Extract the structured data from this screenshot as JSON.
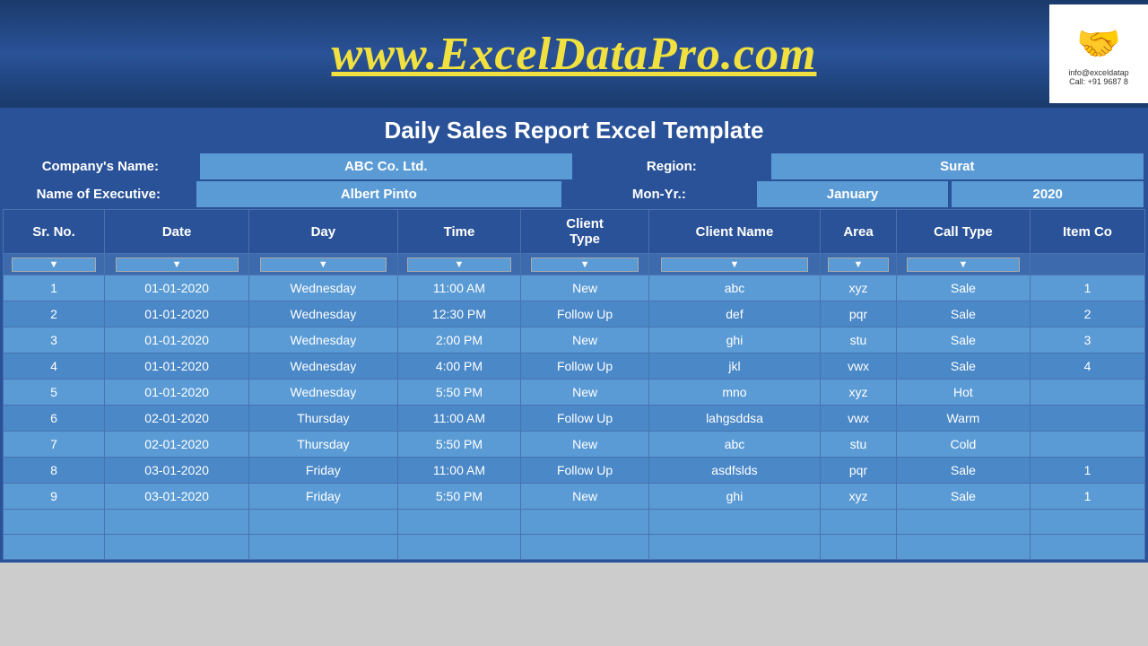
{
  "header": {
    "site_url": "www.ExcelDataPro.com",
    "logo_info": "info@exceldatap\nCall: +91 9687 8",
    "logo_emoji": "🤝"
  },
  "report_title": "Daily Sales Report Excel Template",
  "company_info": {
    "company_label": "Company's Name:",
    "company_value": "ABC Co. Ltd.",
    "region_label": "Region:",
    "region_value": "Surat",
    "executive_label": "Name of Executive:",
    "executive_value": "Albert Pinto",
    "mon_yr_label": "Mon-Yr.:",
    "mon_yr_value": "January",
    "year_value": "2020"
  },
  "columns": [
    "Sr. No.",
    "Date",
    "Day",
    "Time",
    "Client\nType",
    "Client Name",
    "Area",
    "Call Type",
    "Item Co"
  ],
  "rows": [
    {
      "sr": "1",
      "date": "01-01-2020",
      "day": "Wednesday",
      "time": "11:00 AM",
      "client_type": "New",
      "client_name": "abc",
      "area": "xyz",
      "call_type": "Sale",
      "item_code": "1"
    },
    {
      "sr": "2",
      "date": "01-01-2020",
      "day": "Wednesday",
      "time": "12:30 PM",
      "client_type": "Follow Up",
      "client_name": "def",
      "area": "pqr",
      "call_type": "Sale",
      "item_code": "2"
    },
    {
      "sr": "3",
      "date": "01-01-2020",
      "day": "Wednesday",
      "time": "2:00 PM",
      "client_type": "New",
      "client_name": "ghi",
      "area": "stu",
      "call_type": "Sale",
      "item_code": "3"
    },
    {
      "sr": "4",
      "date": "01-01-2020",
      "day": "Wednesday",
      "time": "4:00 PM",
      "client_type": "Follow Up",
      "client_name": "jkl",
      "area": "vwx",
      "call_type": "Sale",
      "item_code": "4"
    },
    {
      "sr": "5",
      "date": "01-01-2020",
      "day": "Wednesday",
      "time": "5:50 PM",
      "client_type": "New",
      "client_name": "mno",
      "area": "xyz",
      "call_type": "Hot",
      "item_code": ""
    },
    {
      "sr": "6",
      "date": "02-01-2020",
      "day": "Thursday",
      "time": "11:00 AM",
      "client_type": "Follow Up",
      "client_name": "lahgsddsa",
      "area": "vwx",
      "call_type": "Warm",
      "item_code": ""
    },
    {
      "sr": "7",
      "date": "02-01-2020",
      "day": "Thursday",
      "time": "5:50 PM",
      "client_type": "New",
      "client_name": "abc",
      "area": "stu",
      "call_type": "Cold",
      "item_code": ""
    },
    {
      "sr": "8",
      "date": "03-01-2020",
      "day": "Friday",
      "time": "11:00 AM",
      "client_type": "Follow Up",
      "client_name": "asdfslds",
      "area": "pqr",
      "call_type": "Sale",
      "item_code": "1"
    },
    {
      "sr": "9",
      "date": "03-01-2020",
      "day": "Friday",
      "time": "5:50 PM",
      "client_type": "New",
      "client_name": "ghi",
      "area": "xyz",
      "call_type": "Sale",
      "item_code": "1"
    }
  ]
}
